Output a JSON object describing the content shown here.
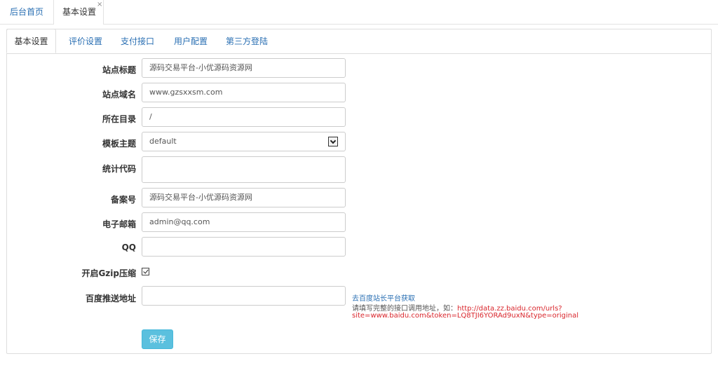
{
  "top_tabs": {
    "home": "后台首页",
    "active": "基本设置",
    "close_glyph": "×"
  },
  "sub_tabs": [
    "基本设置",
    "评价设置",
    "支付接口",
    "用户配置",
    "第三方登陆"
  ],
  "form": {
    "site_title": {
      "label": "站点标题",
      "value": "源码交易平台-小优源码资源网"
    },
    "site_domain": {
      "label": "站点域名",
      "value": "www.gzsxxsm.com"
    },
    "directory": {
      "label": "所在目录",
      "value": "/"
    },
    "theme": {
      "label": "模板主题",
      "value": "default"
    },
    "stats_code": {
      "label": "统计代码",
      "value": ""
    },
    "icp": {
      "label": "备案号",
      "value": "源码交易平台-小优源码资源网"
    },
    "email": {
      "label": "电子邮箱",
      "value": "admin@qq.com"
    },
    "qq": {
      "label": "QQ",
      "value": ""
    },
    "gzip": {
      "label": "开启Gzip压缩",
      "checked": true
    },
    "baidu_push": {
      "label": "百度推送地址",
      "value": "",
      "help_link": "去百度站长平台获取",
      "help_prefix": "请填写完整的接口调用地址，如：",
      "help_url_part1": "http://data.zz.baidu.com/urls?",
      "help_url_part2": "site=www.baidu.com&token=LQ8TJI6YORAd9uxN&type=original"
    }
  },
  "save_label": "保存"
}
